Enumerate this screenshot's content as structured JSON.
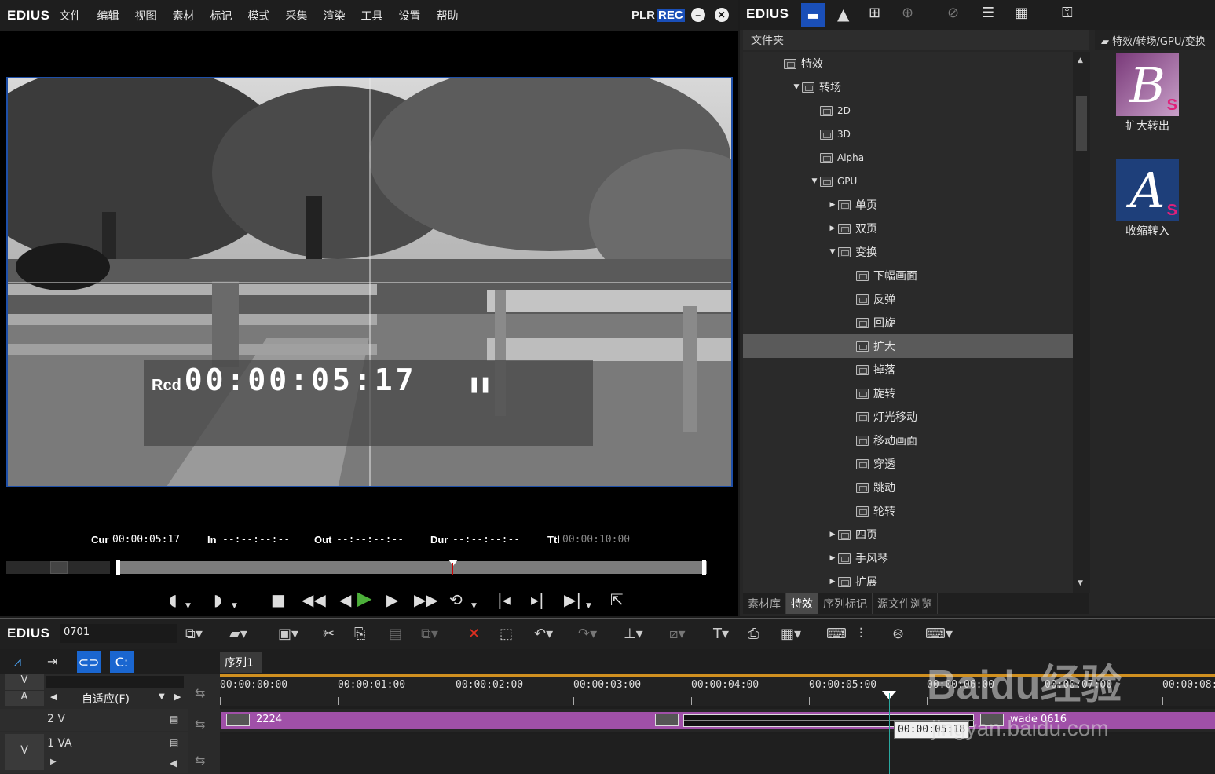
{
  "preview": {
    "brand": "EDIUS",
    "menu": [
      "文件",
      "编辑",
      "视图",
      "素材",
      "标记",
      "模式",
      "采集",
      "渲染",
      "工具",
      "设置",
      "帮助"
    ],
    "plr": "PLR",
    "rec": "REC",
    "timecode_prefix": "Rcd",
    "timecode": "00:00:05:17",
    "status": {
      "cur_label": "Cur",
      "cur_value": "00:00:05:17",
      "in_label": "In",
      "in_value": "--:--:--:--",
      "out_label": "Out",
      "out_value": "--:--:--:--",
      "dur_label": "Dur",
      "dur_value": "--:--:--:--",
      "ttl_label": "Ttl",
      "ttl_value": "00:00:10:00"
    },
    "playhead_position": 0.57
  },
  "library": {
    "brand": "EDIUS",
    "folder_header": "文件夹",
    "path": "特效/转场/GPU/变换",
    "tree": [
      {
        "label": "特效",
        "indent": 0,
        "arrow": ""
      },
      {
        "label": "转场",
        "indent": 1,
        "arrow": "▼"
      },
      {
        "label": "2D",
        "indent": 2,
        "arrow": ""
      },
      {
        "label": "3D",
        "indent": 2,
        "arrow": ""
      },
      {
        "label": "Alpha",
        "indent": 2,
        "arrow": ""
      },
      {
        "label": "GPU",
        "indent": 2,
        "arrow": "▼"
      },
      {
        "label": "单页",
        "indent": 3,
        "arrow": "▶"
      },
      {
        "label": "双页",
        "indent": 3,
        "arrow": "▶"
      },
      {
        "label": "变换",
        "indent": 3,
        "arrow": "▼"
      },
      {
        "label": "下幅画面",
        "indent": 4,
        "arrow": ""
      },
      {
        "label": "反弹",
        "indent": 4,
        "arrow": ""
      },
      {
        "label": "回旋",
        "indent": 4,
        "arrow": ""
      },
      {
        "label": "扩大",
        "indent": 4,
        "arrow": "",
        "selected": true
      },
      {
        "label": "掉落",
        "indent": 4,
        "arrow": ""
      },
      {
        "label": "旋转",
        "indent": 4,
        "arrow": ""
      },
      {
        "label": "灯光移动",
        "indent": 4,
        "arrow": ""
      },
      {
        "label": "移动画面",
        "indent": 4,
        "arrow": ""
      },
      {
        "label": "穿透",
        "indent": 4,
        "arrow": ""
      },
      {
        "label": "跳动",
        "indent": 4,
        "arrow": ""
      },
      {
        "label": "轮转",
        "indent": 4,
        "arrow": ""
      },
      {
        "label": "四页",
        "indent": 3,
        "arrow": "▶"
      },
      {
        "label": "手风琴",
        "indent": 3,
        "arrow": "▶"
      },
      {
        "label": "扩展",
        "indent": 3,
        "arrow": "▶"
      }
    ],
    "tabs": [
      "素材库",
      "特效",
      "序列标记",
      "源文件浏览"
    ],
    "active_tab": 1,
    "effects": [
      {
        "letter": "B",
        "badge": "S",
        "label": "扩大转出",
        "color": "#7a3a7a"
      },
      {
        "letter": "A",
        "badge": "S",
        "label": "收缩转入",
        "color": "#1e3f7a"
      }
    ]
  },
  "timeline": {
    "brand": "EDIUS",
    "project": "0701",
    "sequence_tab": "序列1",
    "fit_label": "自适应(F)",
    "ruler": [
      "00:00:00:00",
      "00:00:01:00",
      "00:00:02:00",
      "00:00:03:00",
      "00:00:04:00",
      "00:00:05:00",
      "00:00:06:00",
      "00:00:07:00",
      "00:00:08:0"
    ],
    "tracks": [
      {
        "label": "2 V"
      },
      {
        "label": "1 VA"
      }
    ],
    "va_labels": {
      "v": "V",
      "a": "A",
      "v2": "V"
    },
    "clips": {
      "left": "2224",
      "right": "wade 0616"
    },
    "cursor_timecode": "00:00:05:18",
    "watermark_text": "jingyan.baidu.com",
    "watermark_brand": "Baidu经验"
  }
}
